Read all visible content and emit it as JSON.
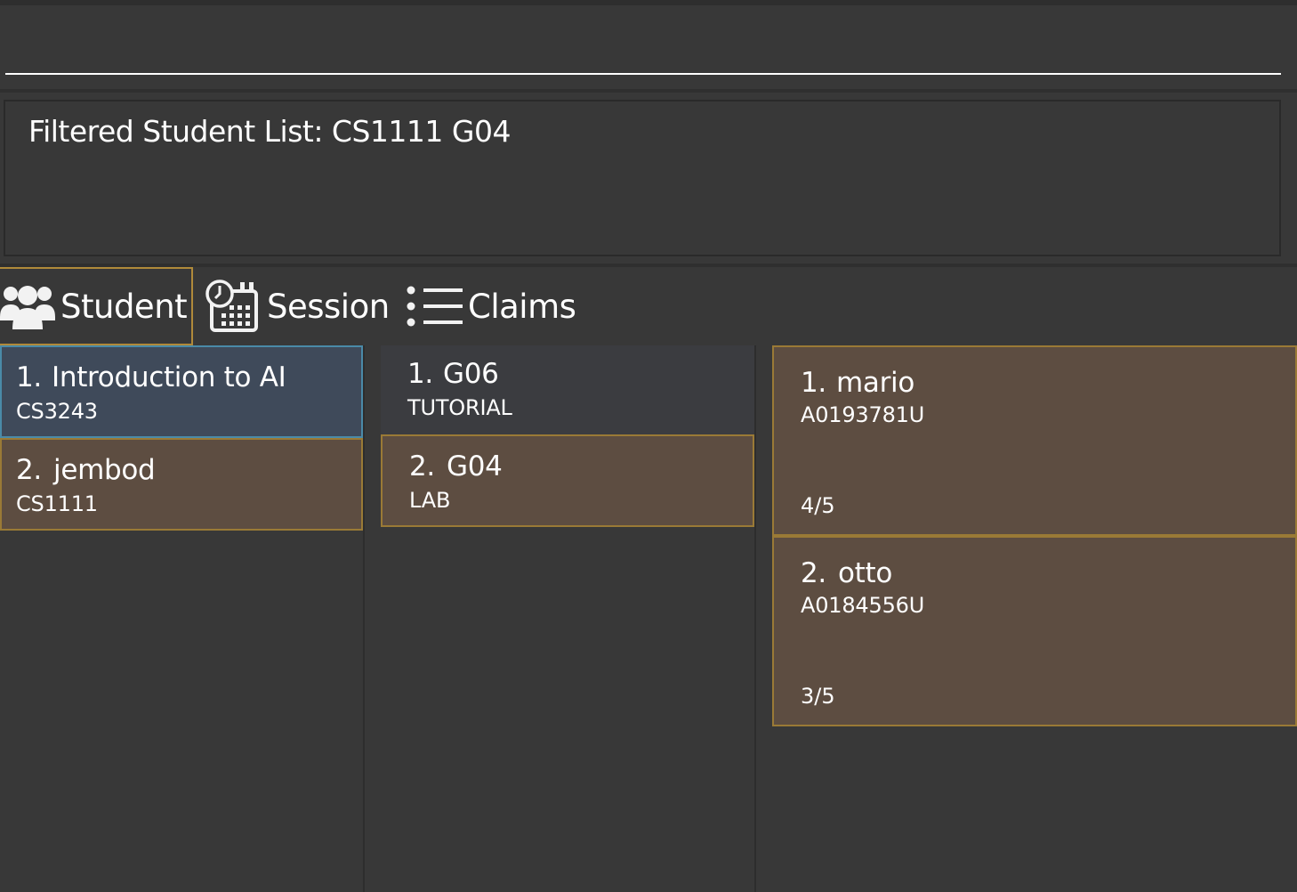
{
  "command": {
    "value": "",
    "placeholder": ""
  },
  "result": {
    "text": "Filtered Student List: CS1111 G04"
  },
  "tabs": [
    {
      "label": "Student",
      "icon": "group-icon",
      "active": true
    },
    {
      "label": "Session",
      "icon": "calendar-clock-icon",
      "active": false
    },
    {
      "label": "Claims",
      "icon": "list-icon",
      "active": false
    }
  ],
  "modules": [
    {
      "index": "1.",
      "name": "Introduction to AI",
      "code": "CS3243",
      "selected": true
    },
    {
      "index": "2.",
      "name": "jembod",
      "code": "CS1111",
      "selected": false
    }
  ],
  "sessions": [
    {
      "index": "1.",
      "name": "G06",
      "type": "TUTORIAL"
    },
    {
      "index": "2.",
      "name": "G04",
      "type": "LAB"
    }
  ],
  "students": [
    {
      "index": "1.",
      "name": "mario",
      "matric": "A0193781U",
      "attendance": "4/5"
    },
    {
      "index": "2.",
      "name": "otto",
      "matric": "A0184556U",
      "attendance": "3/5"
    }
  ],
  "colors": {
    "background": "#383838",
    "card": "#5d4d41",
    "card_border": "#9a7a36",
    "selected_card": "#3f4a5a",
    "selected_border": "#4a8aa8"
  }
}
